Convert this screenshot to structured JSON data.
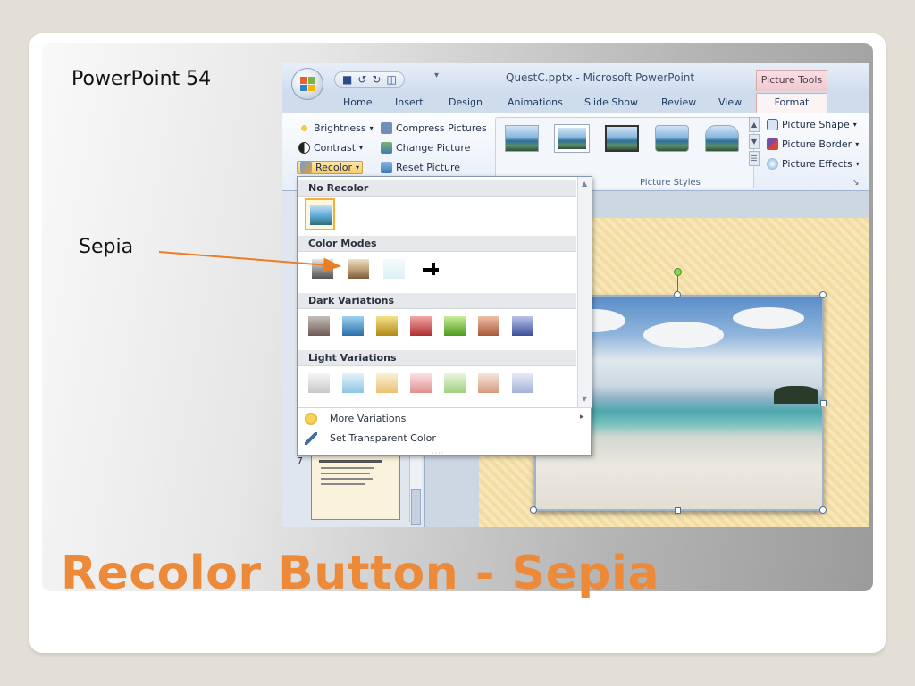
{
  "slide": {
    "label": "PowerPoint 54",
    "callout": "Sepia",
    "title": "Recolor Button - Sepia"
  },
  "app": {
    "doc_title": "QuestC.pptx - Microsoft PowerPoint",
    "context_tab": "Picture Tools",
    "tabs": [
      "Home",
      "Insert",
      "Design",
      "Animations",
      "Slide Show",
      "Review",
      "View"
    ],
    "active_tab": "Format"
  },
  "ribbon": {
    "adjust": {
      "brightness": "Brightness",
      "contrast": "Contrast",
      "recolor": "Recolor",
      "compress": "Compress Pictures",
      "change": "Change Picture",
      "reset": "Reset Picture"
    },
    "styles_label": "Picture Styles",
    "picture_shape": "Picture Shape",
    "picture_border": "Picture Border",
    "picture_effects": "Picture Effects"
  },
  "recolor_menu": {
    "no_recolor": "No Recolor",
    "color_modes": "Color Modes",
    "dark_variations": "Dark Variations",
    "light_variations": "Light Variations",
    "more_variations": "More Variations",
    "set_transparent": "Set Transparent Color"
  },
  "thumbnail": {
    "slide_number": "7"
  },
  "colors": {
    "accent_title": "#ec8a3a",
    "arrow": "#ec7d22"
  }
}
